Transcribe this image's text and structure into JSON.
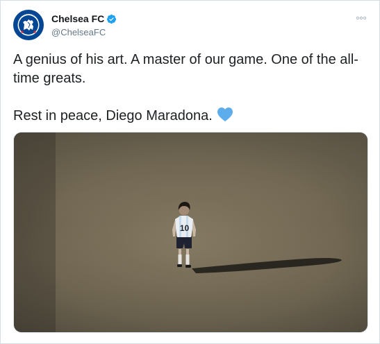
{
  "account": {
    "display_name": "Chelsea FC",
    "handle": "@ChelseaFC",
    "avatar_icon": "chelsea-crest-icon",
    "verified": true,
    "badge_color": "#1da1f2"
  },
  "tweet": {
    "line1": "A genius of his art. A master of our game. One of the all-time greats.",
    "line2": "Rest in peace, Diego Maradona.",
    "emoji": "blue-heart-icon"
  },
  "media": {
    "type": "photo",
    "player_number": "10"
  },
  "menu": {
    "icon": "more-options-icon"
  },
  "colors": {
    "text": "#1c2022",
    "secondary_text": "#657786",
    "heart": "#5dadec",
    "crest_blue": "#034694"
  }
}
